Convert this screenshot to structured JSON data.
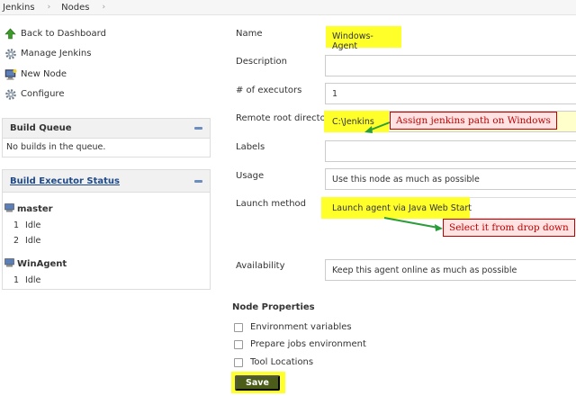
{
  "breadcrumb": {
    "items": [
      "Jenkins",
      "Nodes"
    ]
  },
  "tasks": [
    {
      "label": "Back to Dashboard",
      "icon": "up-arrow-icon"
    },
    {
      "label": "Manage Jenkins",
      "icon": "gear-icon"
    },
    {
      "label": "New Node",
      "icon": "computer-icon"
    },
    {
      "label": "Configure",
      "icon": "gear-icon"
    }
  ],
  "build_queue": {
    "title": "Build Queue",
    "empty_text": "No builds in the queue."
  },
  "executor_status": {
    "title": "Build Executor Status",
    "nodes": [
      {
        "name": "master",
        "executors": [
          {
            "num": "1",
            "state": "Idle"
          },
          {
            "num": "2",
            "state": "Idle"
          }
        ]
      },
      {
        "name": "WinAgent",
        "executors": [
          {
            "num": "1",
            "state": "Idle"
          }
        ]
      }
    ]
  },
  "form": {
    "name_label": "Name",
    "name_value": "Windows-Agent",
    "description_label": "Description",
    "description_value": "",
    "executors_label": "# of executors",
    "executors_value": "1",
    "remote_root_label": "Remote root directory",
    "remote_root_value": "C:\\Jenkins",
    "labels_label": "Labels",
    "labels_value": "",
    "usage_label": "Usage",
    "usage_value": "Use this node as much as possible",
    "launch_label": "Launch method",
    "launch_value": "Launch agent via Java Web Start",
    "availability_label": "Availability",
    "availability_value": "Keep this agent online as much as possible"
  },
  "node_properties": {
    "title": "Node Properties",
    "items": [
      "Environment variables",
      "Prepare jobs environment",
      "Tool Locations"
    ]
  },
  "save_label": "Save",
  "annotations": {
    "remote_root_callout": "Assign jenkins path on Windows",
    "launch_callout": "Select it from drop down"
  },
  "colors": {
    "highlight": "#ffff2a",
    "arrow": "#2a9d3a",
    "callout_border": "#c00000",
    "save_bg": "#4b5d18"
  }
}
